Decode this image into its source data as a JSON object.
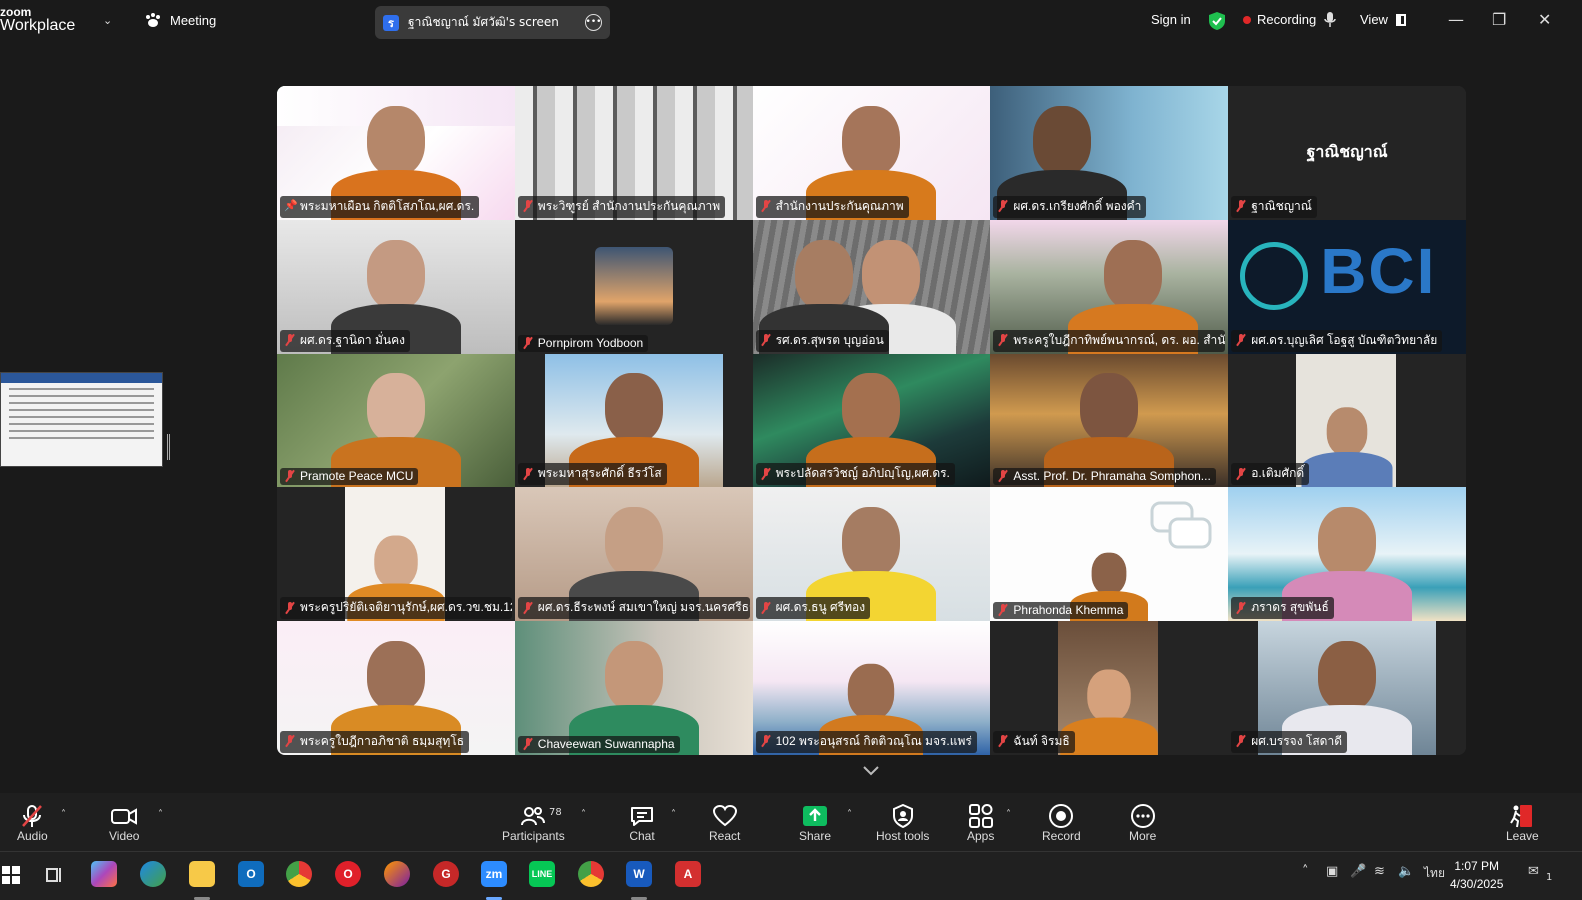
{
  "app": {
    "logo_line1": "zoom",
    "logo_line2": "Workplace",
    "meeting_label": "Meeting",
    "screen_share_label": "ฐาณิชญาณ์ มัศวัฒิ's screen",
    "sign_in": "Sign in",
    "recording": "Recording",
    "view": "View"
  },
  "participants": [
    {
      "name": "พระมหาเผือน กิตติโสภโณ,ผศ.ดร.",
      "pinned": true,
      "active": true
    },
    {
      "name": "พระวิฑูรย์ สำนักงานประกันคุณภาพ"
    },
    {
      "name": "สำนักงานประกันคุณภาพ"
    },
    {
      "name": "ผศ.ดร.เกรียงศักดิ์ พองคำ"
    },
    {
      "name": "ฐาณิชญาณ์",
      "center_text": "ฐาณิชญาณ์"
    },
    {
      "name": "ผศ.ดร.ฐานิดา มั่นคง"
    },
    {
      "name": "Pornpirom Yodboon"
    },
    {
      "name": "รศ.ดร.สุพรต บุญอ่อน"
    },
    {
      "name": "พระครูใบฎีกาทิพย์พนากรณ์, ดร. ผอ. สำนั..."
    },
    {
      "name": "ผศ.ดร.บุญเลิศ โอฐสู บัณฑิตวิทยาลัย",
      "center_text": "BCI"
    },
    {
      "name": "Pramote  Peace  MCU"
    },
    {
      "name": "พระมหาสุระศักดิ์ ธีรวํโส"
    },
    {
      "name": "พระปลัดสรวิชญ์ อภิปญฺโญ,ผศ.ดร."
    },
    {
      "name": "Asst. Prof. Dr. Phramaha Somphon..."
    },
    {
      "name": "อ.เติมศักดิ์"
    },
    {
      "name": "พระครูปริยัติเจติยานุรักษ์,ผศ.ดร.วข.ชม.12..."
    },
    {
      "name": "ผศ.ดร.ธีระพงษ์ สมเขาใหญ่ มจร.นครศรีธร..."
    },
    {
      "name": "ผศ.ดร.ธนู ศรีทอง"
    },
    {
      "name": "Phrahonda Khemma"
    },
    {
      "name": "ภราดร สุขพันธ์"
    },
    {
      "name": "พระครูใบฎีกาอภิชาติ ธมฺมสุทฺโธ"
    },
    {
      "name": "Chaveewan Suwannapha"
    },
    {
      "name": "102 พระอนุสรณ์ กิตติวณฺโณ มจร.แพร่"
    },
    {
      "name": "ฉันท์ จิรมธิ"
    },
    {
      "name": "ผศ.บรรจง โสดาดี"
    }
  ],
  "toolbar": {
    "audio": "Audio",
    "video": "Video",
    "participants": "Participants",
    "participants_count": "78",
    "chat": "Chat",
    "react": "React",
    "share": "Share",
    "host_tools": "Host tools",
    "apps": "Apps",
    "record": "Record",
    "more": "More",
    "leave": "Leave"
  },
  "taskbar": {
    "lang": "ไทย",
    "time": "1:07 PM",
    "date": "4/30/2025",
    "notif_count": "1"
  },
  "colors": {
    "accent_green": "#2ecc71",
    "recording_red": "#e02828",
    "share_green": "#0ebc5f",
    "leave_red": "#e02828"
  }
}
